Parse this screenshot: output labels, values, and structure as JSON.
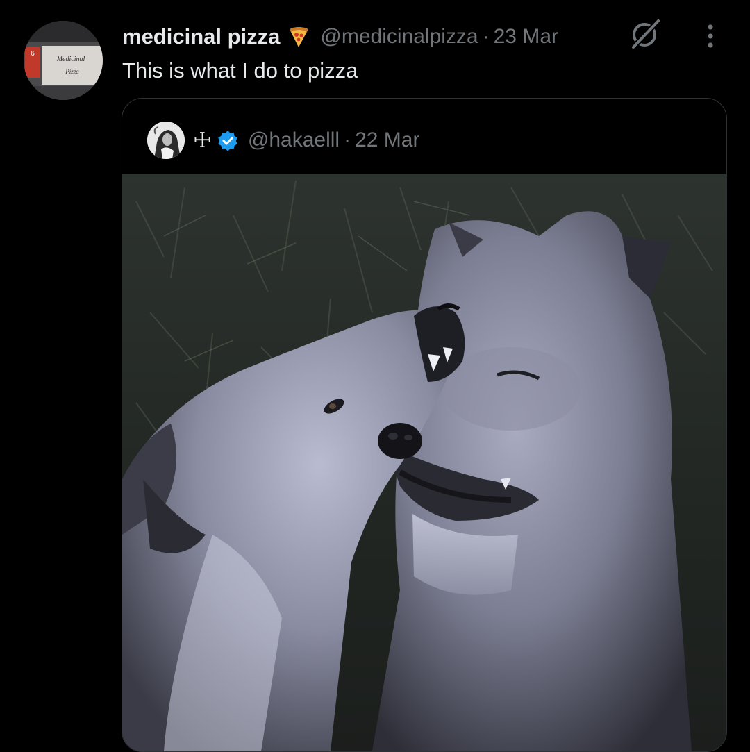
{
  "tweet": {
    "display_name": "medicinal pizza",
    "name_emoji": "pizza-slice-icon",
    "handle": "@medicinalpizza",
    "separator": "·",
    "timestamp": "23 Mar",
    "text": "This is what I do to pizza",
    "avatar_sign": {
      "number": "6",
      "line1": "Medicinal",
      "line2": "Pizza"
    }
  },
  "actions": {
    "grok_icon": "grok-icon",
    "more_icon": "more-vertical-icon"
  },
  "quote": {
    "display_name": "☩",
    "verified_icon": "verified-badge-icon",
    "handle": "@hakaelll",
    "separator": "·",
    "timestamp": "22 Mar",
    "media_subject": "two-wolves-photo"
  },
  "colors": {
    "background": "#000000",
    "primary_text": "#e7e9ea",
    "secondary_text": "#71767b",
    "border": "#2f3336",
    "verified": "#1d9bf0"
  }
}
